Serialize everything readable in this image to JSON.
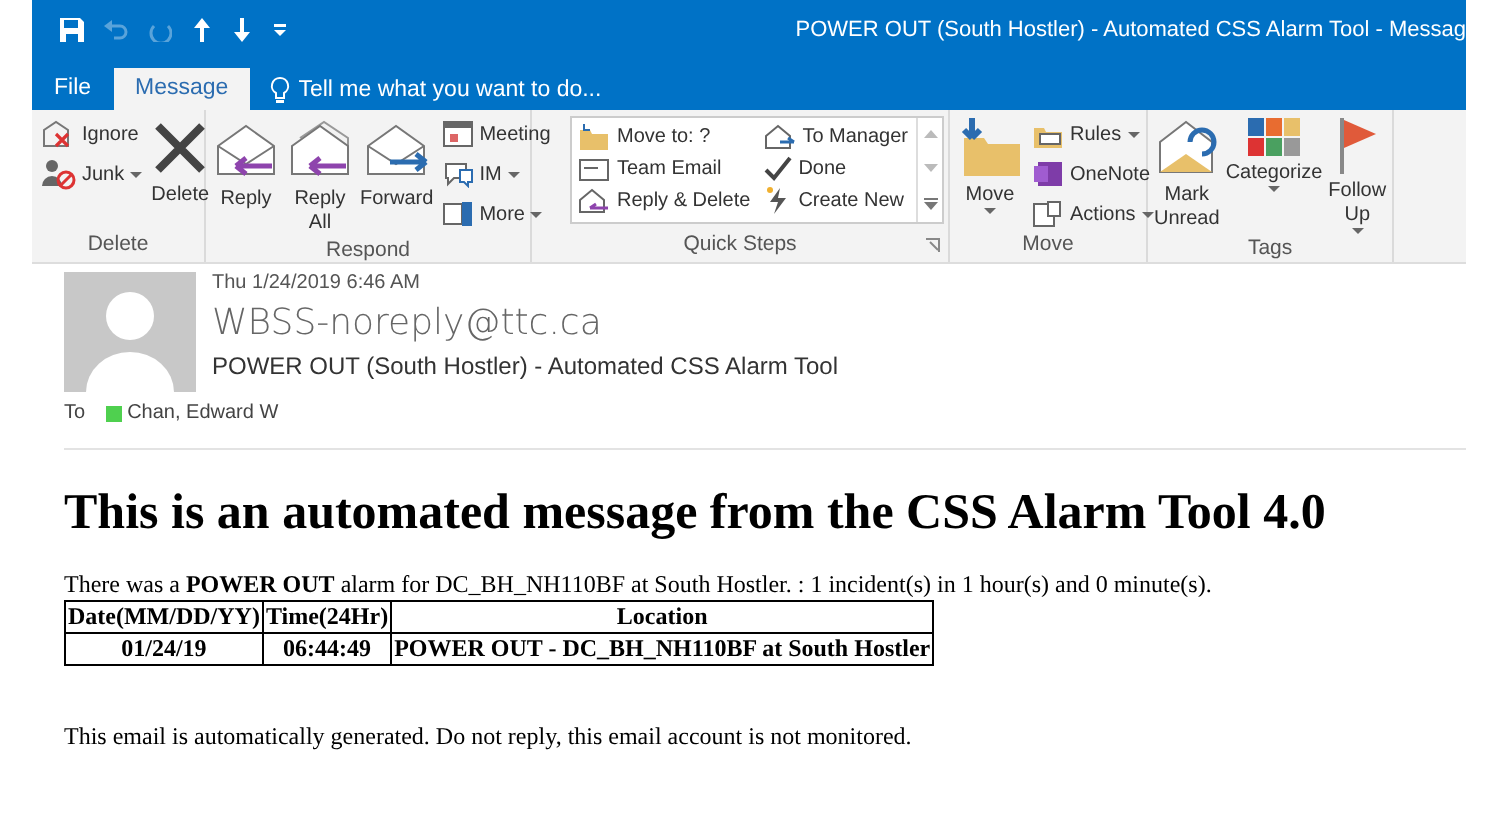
{
  "window": {
    "title": "POWER OUT (South Hostler) - Automated CSS Alarm Tool - Messag"
  },
  "quick_access": [
    {
      "disabled": false
    },
    {
      "disabled": true
    },
    {
      "disabled": true
    },
    {
      "disabled": false
    },
    {
      "disabled": false
    },
    {
      "disabled": false
    }
  ],
  "tabs": [
    {
      "label": "File",
      "selected": false
    },
    {
      "label": "Message",
      "selected": true
    }
  ],
  "tell_me": {
    "placeholder": "Tell me what you want to do..."
  },
  "ribbon_groups": [
    {
      "label": "Delete",
      "columns": [
        {
          "kind": "stack",
          "items": [
            {
              "label": "Ignore",
              "dropdown": false
            },
            {
              "label": "Junk",
              "dropdown": true
            }
          ]
        },
        {
          "kind": "large",
          "items": [
            {
              "label": "Delete",
              "dropdown": false
            }
          ]
        }
      ]
    },
    {
      "label": "Respond",
      "columns": [
        {
          "kind": "large",
          "items": [
            {
              "label": "Reply",
              "dropdown": false
            }
          ]
        },
        {
          "kind": "large",
          "items": [
            {
              "label": "Reply All",
              "dropdown": false
            }
          ]
        },
        {
          "kind": "large",
          "items": [
            {
              "label": "Forward",
              "dropdown": false
            }
          ]
        },
        {
          "kind": "stack",
          "items": [
            {
              "label": "Meeting",
              "dropdown": false
            },
            {
              "label": "IM",
              "dropdown": true
            },
            {
              "label": "More",
              "dropdown": true
            }
          ]
        }
      ]
    },
    {
      "label": "Quick Steps",
      "columns": [
        {
          "kind": "gallery",
          "items": [
            {
              "label": "Move to: ?",
              "dropdown": false
            },
            {
              "label": "Team Email",
              "dropdown": false
            },
            {
              "label": "Reply & Delete",
              "dropdown": false
            },
            {
              "label": "To Manager",
              "dropdown": false
            },
            {
              "label": "Done",
              "dropdown": false
            },
            {
              "label": "Create New",
              "dropdown": false
            }
          ]
        }
      ]
    },
    {
      "label": "Move",
      "columns": [
        {
          "kind": "large",
          "items": [
            {
              "label": "Move",
              "dropdown": true
            }
          ]
        },
        {
          "kind": "stack",
          "items": [
            {
              "label": "Rules",
              "dropdown": true
            },
            {
              "label": "OneNote",
              "dropdown": false
            },
            {
              "label": "Actions",
              "dropdown": true
            }
          ]
        }
      ]
    },
    {
      "label": "Tags",
      "columns": [
        {
          "kind": "large",
          "items": [
            {
              "label": "Mark Unread",
              "dropdown": false
            }
          ]
        },
        {
          "kind": "large",
          "items": [
            {
              "label": "Categorize",
              "dropdown": true
            }
          ]
        },
        {
          "kind": "large",
          "items": [
            {
              "label": "Follow Up",
              "dropdown": true
            }
          ]
        }
      ]
    }
  ],
  "header": {
    "date": "Thu 1/24/2019 6:46 AM",
    "sender": "WBSS-noreply@ttc.ca",
    "subject": "POWER OUT (South Hostler) - Automated CSS Alarm Tool",
    "to_label": "To",
    "recipients": [
      {
        "name": "Chan, Edward W",
        "color": "#4fd04f"
      }
    ]
  },
  "body": {
    "heading": "This is an automated message from the CSS Alarm Tool 4.0",
    "intro": "There was a **POWER OUT** alarm for DC_BH_NH110BF at South Hostler. : 1 incident(s) in 1 hour(s) and 0 minute(s).",
    "table": {
      "columns": [
        "Date(MM/DD/YY)",
        "Time(24Hr)",
        "Location"
      ],
      "rows": [
        [
          "01/24/19",
          "06:44:49",
          "POWER OUT - DC_BH_NH110BF at South Hostler"
        ]
      ]
    },
    "footer": "This email is automatically generated. Do not reply, this email account is not monitored."
  }
}
